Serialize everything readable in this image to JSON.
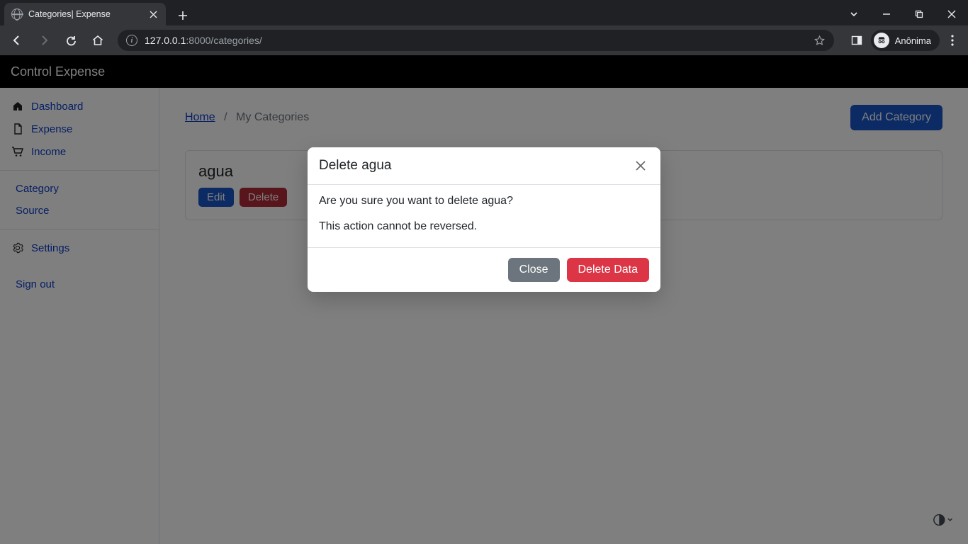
{
  "browser": {
    "tab_title": "Categories| Expense",
    "url_host": "127.0.0.1",
    "url_port_path": ":8000/categories/",
    "profile_label": "Anônima"
  },
  "app": {
    "brand": "Control Expense",
    "sidebar": {
      "group1": [
        {
          "label": "Dashboard"
        },
        {
          "label": "Expense"
        },
        {
          "label": "Income"
        }
      ],
      "group2": [
        {
          "label": "Category"
        },
        {
          "label": "Source"
        }
      ],
      "settings_label": "Settings",
      "signout_label": "Sign out"
    },
    "breadcrumb": {
      "home": "Home",
      "current": "My Categories"
    },
    "add_button": "Add Category",
    "card": {
      "title": "agua",
      "edit": "Edit",
      "delete": "Delete"
    }
  },
  "modal": {
    "title": "Delete agua",
    "line1": "Are you sure you want to delete agua?",
    "line2": "This action cannot be reversed.",
    "close": "Close",
    "confirm": "Delete Data"
  }
}
